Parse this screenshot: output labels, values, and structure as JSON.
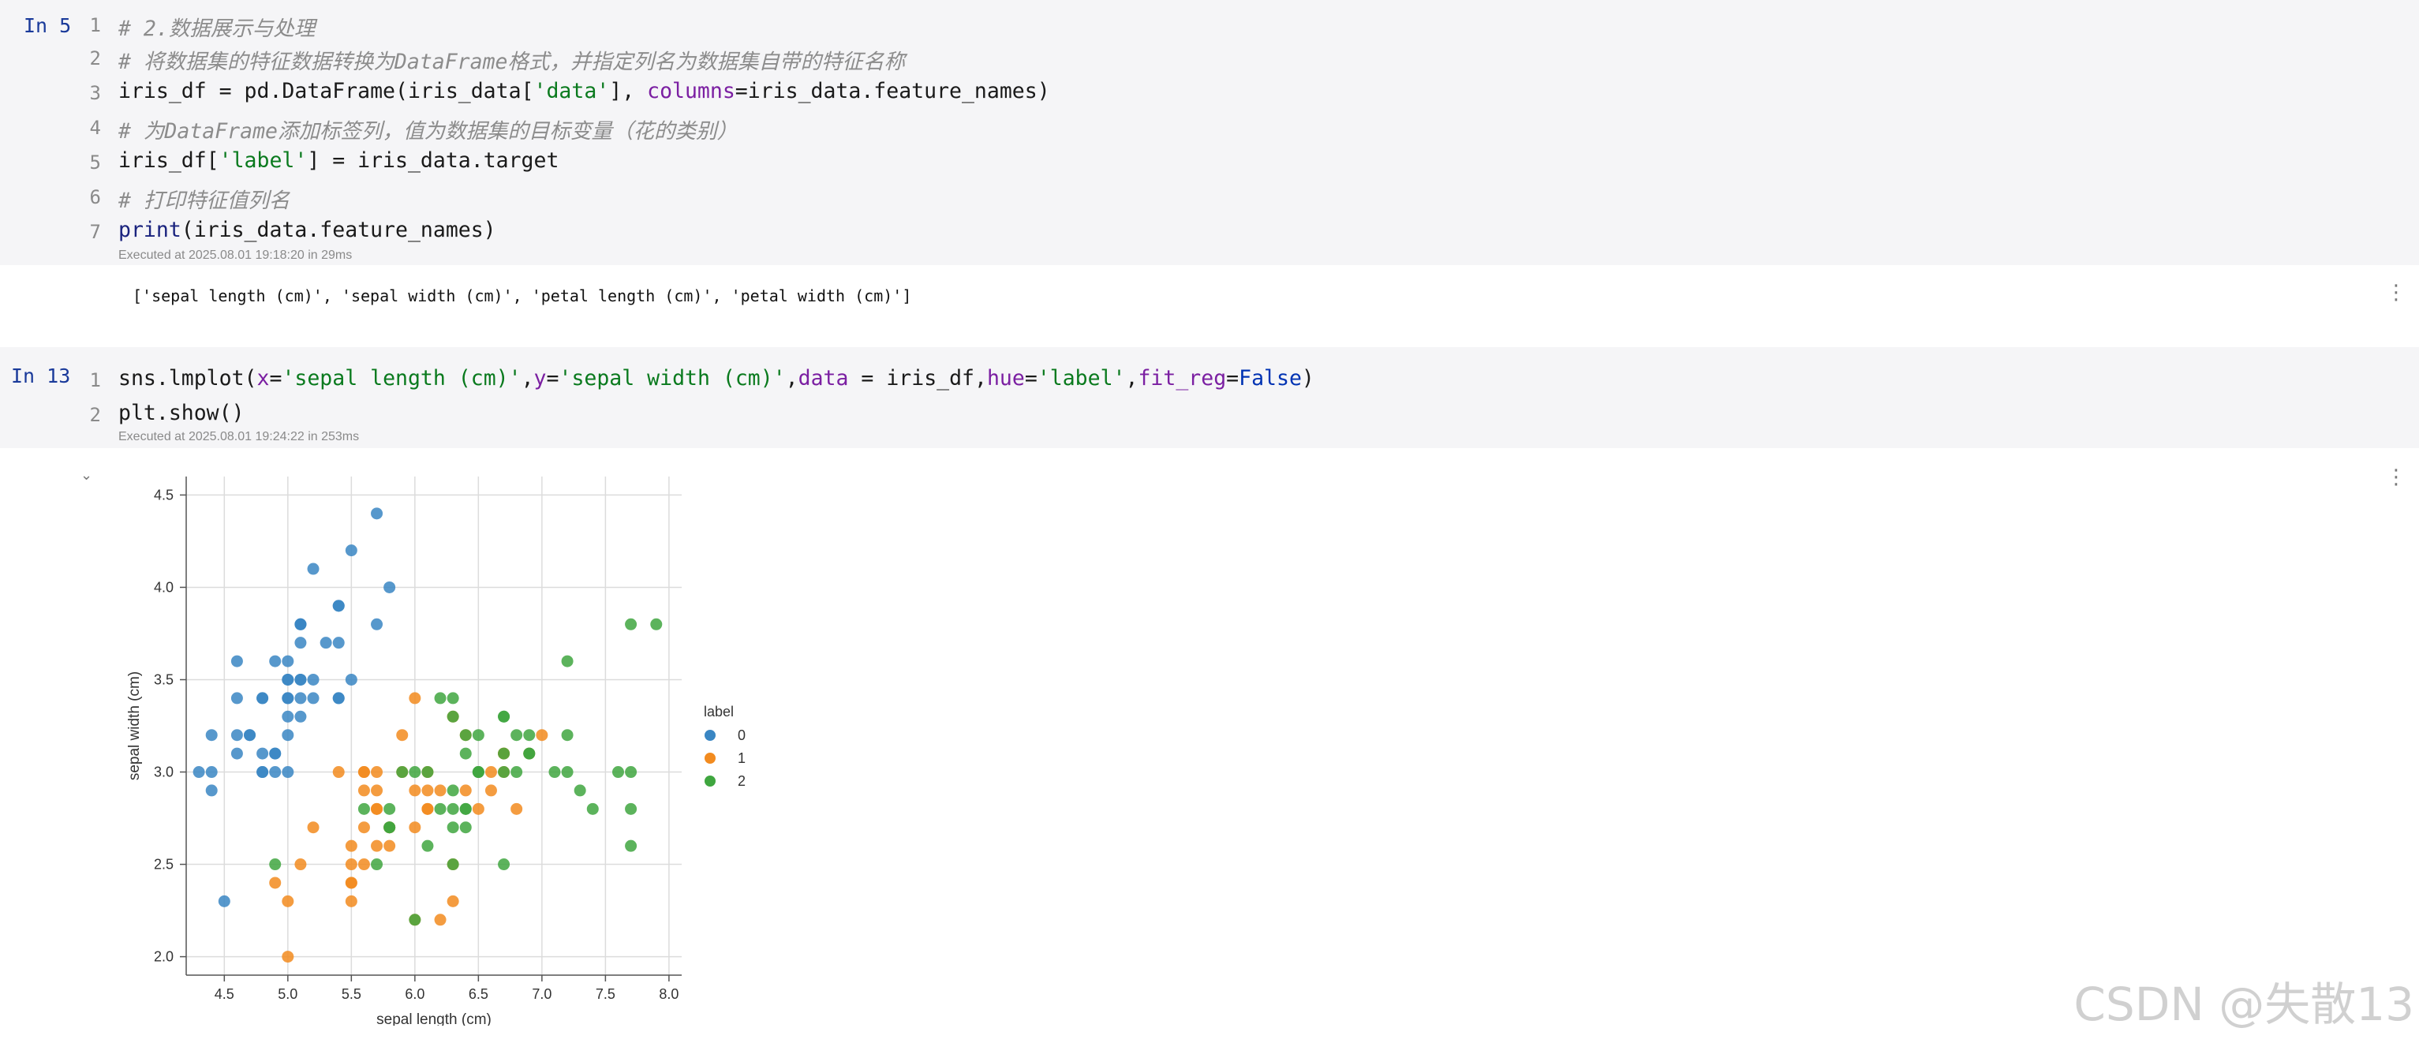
{
  "cells": [
    {
      "prompt": "In 5",
      "lines": [
        {
          "num": "1",
          "tokens": [
            {
              "t": "# 2.数据展示与处理",
              "c": "cm"
            }
          ]
        },
        {
          "num": "2",
          "tokens": [
            {
              "t": "# 将数据集的特征数据转换为DataFrame格式，并指定列名为数据集自带的特征名称",
              "c": "cm"
            }
          ]
        },
        {
          "num": "3",
          "tokens": [
            {
              "t": "iris_df = pd.DataFrame(iris_data[",
              "c": ""
            },
            {
              "t": "'data'",
              "c": "str"
            },
            {
              "t": "], ",
              "c": ""
            },
            {
              "t": "columns",
              "c": "kw"
            },
            {
              "t": "=iris_data.feature_names)",
              "c": ""
            }
          ]
        },
        {
          "num": "4",
          "tokens": [
            {
              "t": "# 为DataFrame添加标签列，值为数据集的目标变量（花的类别）",
              "c": "cm"
            }
          ]
        },
        {
          "num": "5",
          "tokens": [
            {
              "t": "iris_df[",
              "c": ""
            },
            {
              "t": "'label'",
              "c": "str"
            },
            {
              "t": "] = iris_data.target",
              "c": ""
            }
          ]
        },
        {
          "num": "6",
          "tokens": [
            {
              "t": "# 打印特征值列名",
              "c": "cm"
            }
          ]
        },
        {
          "num": "7",
          "tokens": [
            {
              "t": "print",
              "c": "bi"
            },
            {
              "t": "(iris_data.feature_names)",
              "c": ""
            }
          ]
        }
      ],
      "executed": "Executed at 2025.08.01 19:18:20 in 29ms",
      "output": "['sepal length (cm)', 'sepal width (cm)', 'petal length (cm)', 'petal width (cm)']"
    },
    {
      "prompt": "In 13",
      "lines": [
        {
          "num": "1",
          "tokens": [
            {
              "t": "sns.lmplot(",
              "c": ""
            },
            {
              "t": "x",
              "c": "kw"
            },
            {
              "t": "=",
              "c": ""
            },
            {
              "t": "'sepal length (cm)'",
              "c": "str"
            },
            {
              "t": ",",
              "c": ""
            },
            {
              "t": "y",
              "c": "kw"
            },
            {
              "t": "=",
              "c": ""
            },
            {
              "t": "'sepal width (cm)'",
              "c": "str"
            },
            {
              "t": ",",
              "c": ""
            },
            {
              "t": "data",
              "c": "kw"
            },
            {
              "t": " = iris_df,",
              "c": ""
            },
            {
              "t": "hue",
              "c": "kw"
            },
            {
              "t": "=",
              "c": ""
            },
            {
              "t": "'label'",
              "c": "str"
            },
            {
              "t": ",",
              "c": ""
            },
            {
              "t": "fit_reg",
              "c": "kw"
            },
            {
              "t": "=",
              "c": ""
            },
            {
              "t": "False",
              "c": "const"
            },
            {
              "t": ")",
              "c": ""
            }
          ]
        },
        {
          "num": "2",
          "tokens": [
            {
              "t": "plt.show()",
              "c": ""
            }
          ]
        }
      ],
      "executed": "Executed at 2025.08.01 19:24:22 in 253ms"
    }
  ],
  "icons": {
    "more": "kebab-menu-icon",
    "collapse": "chevron-down-icon"
  },
  "watermark": "CSDN @失散13",
  "colors": {
    "label0": "#3a86c3",
    "label1": "#f28b1f",
    "label2": "#3fa63f",
    "prompt": "#1a3a9a",
    "string": "#0a7a1e",
    "keyword": "#7b1fa2"
  },
  "chart_data": {
    "type": "scatter",
    "title": "",
    "xlabel": "sepal length (cm)",
    "ylabel": "sepal width (cm)",
    "xlim": [
      4.2,
      8.1
    ],
    "ylim": [
      1.9,
      4.6
    ],
    "xticks": [
      "4.5",
      "5.0",
      "5.5",
      "6.0",
      "6.5",
      "7.0",
      "7.5",
      "8.0"
    ],
    "yticks": [
      "2.0",
      "2.5",
      "3.0",
      "3.5",
      "4.0",
      "4.5"
    ],
    "grid": true,
    "legend_title": "label",
    "legend_position": "right",
    "series": [
      {
        "name": "0",
        "color": "#3a86c3",
        "points": [
          [
            5.1,
            3.5
          ],
          [
            4.9,
            3.0
          ],
          [
            4.7,
            3.2
          ],
          [
            4.6,
            3.1
          ],
          [
            5.0,
            3.6
          ],
          [
            5.4,
            3.9
          ],
          [
            4.6,
            3.4
          ],
          [
            5.0,
            3.4
          ],
          [
            4.4,
            2.9
          ],
          [
            4.9,
            3.1
          ],
          [
            5.4,
            3.7
          ],
          [
            4.8,
            3.4
          ],
          [
            4.8,
            3.0
          ],
          [
            4.3,
            3.0
          ],
          [
            5.8,
            4.0
          ],
          [
            5.7,
            4.4
          ],
          [
            5.4,
            3.9
          ],
          [
            5.1,
            3.5
          ],
          [
            5.7,
            3.8
          ],
          [
            5.1,
            3.8
          ],
          [
            5.4,
            3.4
          ],
          [
            5.1,
            3.7
          ],
          [
            4.6,
            3.6
          ],
          [
            5.1,
            3.3
          ],
          [
            4.8,
            3.4
          ],
          [
            5.0,
            3.0
          ],
          [
            5.0,
            3.4
          ],
          [
            5.2,
            3.5
          ],
          [
            5.2,
            3.4
          ],
          [
            4.7,
            3.2
          ],
          [
            4.8,
            3.1
          ],
          [
            5.4,
            3.4
          ],
          [
            5.2,
            4.1
          ],
          [
            5.5,
            4.2
          ],
          [
            4.9,
            3.1
          ],
          [
            5.0,
            3.2
          ],
          [
            5.5,
            3.5
          ],
          [
            4.9,
            3.6
          ],
          [
            4.4,
            3.0
          ],
          [
            5.1,
            3.4
          ],
          [
            5.0,
            3.5
          ],
          [
            4.5,
            2.3
          ],
          [
            4.4,
            3.2
          ],
          [
            5.0,
            3.5
          ],
          [
            5.1,
            3.8
          ],
          [
            4.8,
            3.0
          ],
          [
            5.1,
            3.8
          ],
          [
            4.6,
            3.2
          ],
          [
            5.3,
            3.7
          ],
          [
            5.0,
            3.3
          ]
        ]
      },
      {
        "name": "1",
        "color": "#f28b1f",
        "points": [
          [
            7.0,
            3.2
          ],
          [
            6.4,
            3.2
          ],
          [
            6.9,
            3.1
          ],
          [
            5.5,
            2.3
          ],
          [
            6.5,
            2.8
          ],
          [
            5.7,
            2.8
          ],
          [
            6.3,
            3.3
          ],
          [
            4.9,
            2.4
          ],
          [
            6.6,
            2.9
          ],
          [
            5.2,
            2.7
          ],
          [
            5.0,
            2.0
          ],
          [
            5.9,
            3.0
          ],
          [
            6.0,
            2.2
          ],
          [
            6.1,
            2.9
          ],
          [
            5.6,
            2.9
          ],
          [
            6.7,
            3.1
          ],
          [
            5.6,
            3.0
          ],
          [
            5.8,
            2.7
          ],
          [
            6.2,
            2.2
          ],
          [
            5.6,
            2.5
          ],
          [
            5.9,
            3.2
          ],
          [
            6.1,
            2.8
          ],
          [
            6.3,
            2.5
          ],
          [
            6.1,
            2.8
          ],
          [
            6.4,
            2.9
          ],
          [
            6.6,
            3.0
          ],
          [
            6.8,
            2.8
          ],
          [
            6.7,
            3.0
          ],
          [
            6.0,
            2.9
          ],
          [
            5.7,
            2.6
          ],
          [
            5.5,
            2.4
          ],
          [
            5.5,
            2.4
          ],
          [
            5.8,
            2.7
          ],
          [
            6.0,
            2.7
          ],
          [
            5.4,
            3.0
          ],
          [
            6.0,
            3.4
          ],
          [
            6.7,
            3.1
          ],
          [
            6.3,
            2.3
          ],
          [
            5.6,
            3.0
          ],
          [
            5.5,
            2.5
          ],
          [
            5.5,
            2.6
          ],
          [
            6.1,
            3.0
          ],
          [
            5.8,
            2.6
          ],
          [
            5.0,
            2.3
          ],
          [
            5.6,
            2.7
          ],
          [
            5.7,
            3.0
          ],
          [
            5.7,
            2.9
          ],
          [
            6.2,
            2.9
          ],
          [
            5.1,
            2.5
          ],
          [
            5.7,
            2.8
          ]
        ]
      },
      {
        "name": "2",
        "color": "#3fa63f",
        "points": [
          [
            6.3,
            3.3
          ],
          [
            5.8,
            2.7
          ],
          [
            7.1,
            3.0
          ],
          [
            6.3,
            2.9
          ],
          [
            6.5,
            3.0
          ],
          [
            7.6,
            3.0
          ],
          [
            4.9,
            2.5
          ],
          [
            7.3,
            2.9
          ],
          [
            6.7,
            2.5
          ],
          [
            7.2,
            3.6
          ],
          [
            6.5,
            3.2
          ],
          [
            6.4,
            2.7
          ],
          [
            6.8,
            3.0
          ],
          [
            5.7,
            2.5
          ],
          [
            5.8,
            2.8
          ],
          [
            6.4,
            3.2
          ],
          [
            6.5,
            3.0
          ],
          [
            7.7,
            3.8
          ],
          [
            7.7,
            2.6
          ],
          [
            6.0,
            2.2
          ],
          [
            6.9,
            3.2
          ],
          [
            5.6,
            2.8
          ],
          [
            7.7,
            2.8
          ],
          [
            6.3,
            2.7
          ],
          [
            6.7,
            3.3
          ],
          [
            7.2,
            3.2
          ],
          [
            6.2,
            2.8
          ],
          [
            6.1,
            3.0
          ],
          [
            6.4,
            2.8
          ],
          [
            7.2,
            3.0
          ],
          [
            7.4,
            2.8
          ],
          [
            7.9,
            3.8
          ],
          [
            6.4,
            2.8
          ],
          [
            6.3,
            2.8
          ],
          [
            6.1,
            2.6
          ],
          [
            7.7,
            3.0
          ],
          [
            6.3,
            3.4
          ],
          [
            6.4,
            3.1
          ],
          [
            6.0,
            3.0
          ],
          [
            6.9,
            3.1
          ],
          [
            6.7,
            3.1
          ],
          [
            6.9,
            3.1
          ],
          [
            5.8,
            2.7
          ],
          [
            6.8,
            3.2
          ],
          [
            6.7,
            3.3
          ],
          [
            6.7,
            3.0
          ],
          [
            6.3,
            2.5
          ],
          [
            6.5,
            3.0
          ],
          [
            6.2,
            3.4
          ],
          [
            5.9,
            3.0
          ]
        ]
      }
    ]
  }
}
